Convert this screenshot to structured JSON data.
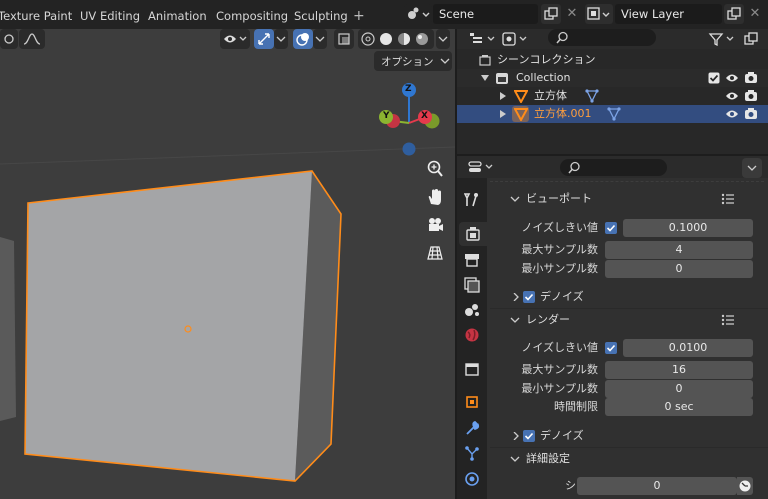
{
  "topbar": {
    "tabs": [
      "Texture Paint",
      "UV Editing",
      "Animation",
      "Compositing",
      "Sculpting"
    ],
    "add_tab": "+",
    "scene": "Scene",
    "view_layer": "View Layer"
  },
  "viewport": {
    "options_label": "オプション",
    "gizmo": {
      "z": "Z",
      "y": "Y",
      "x": "X"
    }
  },
  "outliner": {
    "search_placeholder": "",
    "rows": [
      {
        "label": "シーンコレクション"
      },
      {
        "label": "Collection"
      },
      {
        "label": "立方体"
      },
      {
        "label": "立方体.001"
      }
    ]
  },
  "properties": {
    "search_placeholder": "",
    "viewport_panel": {
      "title": "ビューポート",
      "noise_threshold_label": "ノイズしきい値",
      "noise_threshold": "0.1000",
      "max_samples_label": "最大サンプル数",
      "max_samples": "4",
      "min_samples_label": "最小サンプル数",
      "min_samples": "0",
      "denoise_label": "デノイズ"
    },
    "render_panel": {
      "title": "レンダー",
      "noise_threshold_label": "ノイズしきい値",
      "noise_threshold": "0.0100",
      "max_samples_label": "最大サンプル数",
      "max_samples": "16",
      "min_samples_label": "最小サンプル数",
      "min_samples": "0",
      "time_limit_label": "時間制限",
      "time_limit": "0 sec",
      "denoise_label": "デノイズ"
    },
    "advanced_panel": {
      "title": "詳細設定",
      "seed_label": "シード",
      "seed": "0"
    }
  },
  "colors": {
    "accent": "#4772b3",
    "selection_outline": "#ff8c1a",
    "outliner_selected": "#334d80",
    "viewport_bg": "#3d3d3d",
    "gizmo_x": "#e53a4c",
    "gizmo_y": "#8bb430",
    "gizmo_z": "#2f77d1"
  }
}
